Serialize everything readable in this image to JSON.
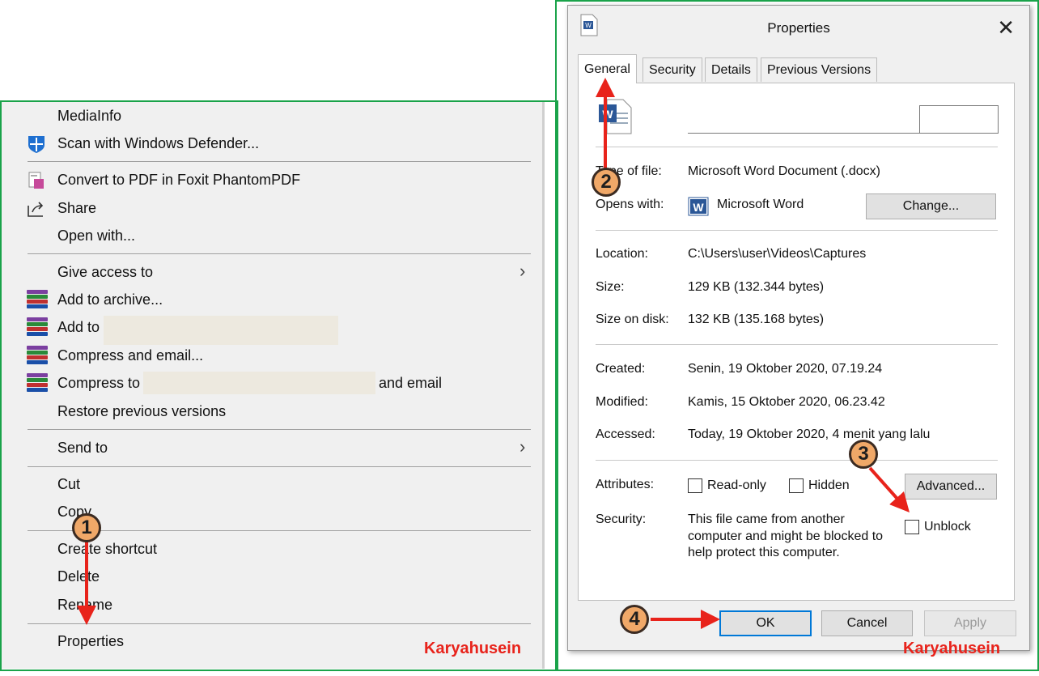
{
  "context_menu": {
    "items": {
      "mediainfo": "MediaInfo",
      "scan_defender": "Scan with Windows Defender...",
      "convert_pdf": "Convert to PDF in Foxit PhantomPDF",
      "share": "Share",
      "open_with": "Open with...",
      "give_access": "Give access to",
      "add_archive": "Add to archive...",
      "add_to": "Add to",
      "compress_email": "Compress and email...",
      "compress_to": "Compress to",
      "compress_to_suffix": "and email",
      "restore_versions": "Restore previous versions",
      "send_to": "Send to",
      "cut": "Cut",
      "copy": "Copy",
      "create_shortcut": "Create shortcut",
      "delete": "Delete",
      "rename": "Rename",
      "properties": "Properties"
    }
  },
  "dialog": {
    "title": "Properties",
    "close_glyph": "✕",
    "tabs": [
      "General",
      "Security",
      "Details",
      "Previous Versions"
    ],
    "type_label": "Type of file:",
    "type_value": "Microsoft Word Document (.docx)",
    "opens_label": "Opens with:",
    "opens_value": "Microsoft Word",
    "change_button": "Change...",
    "location_label": "Location:",
    "location_value": "C:\\Users\\user\\Videos\\Captures",
    "size_label": "Size:",
    "size_value": "129 KB (132.344 bytes)",
    "size_disk_label": "Size on disk:",
    "size_disk_value": "132 KB (135.168 bytes)",
    "created_label": "Created:",
    "created_value": "Senin, 19 Oktober 2020, 07.19.24",
    "modified_label": "Modified:",
    "modified_value": "Kamis, 15 Oktober 2020, 06.23.42",
    "accessed_label": "Accessed:",
    "accessed_value": "Today, 19 Oktober 2020, 4 menit yang lalu",
    "attributes_label": "Attributes:",
    "readonly_label": "Read-only",
    "hidden_label": "Hidden",
    "advanced_button": "Advanced...",
    "security_label": "Security:",
    "security_text_1": "This file came from another",
    "security_text_2": "computer and might be blocked to",
    "security_text_3": "help protect this computer.",
    "unblock_label": "Unblock",
    "ok_button": "OK",
    "cancel_button": "Cancel",
    "apply_button": "Apply"
  },
  "annotations": {
    "step1": "1",
    "step2": "2",
    "step3": "3",
    "step4": "4",
    "watermark": "Karyahusein",
    "arrow_color": "#e8231b",
    "frame_color": "#1aa34a"
  }
}
